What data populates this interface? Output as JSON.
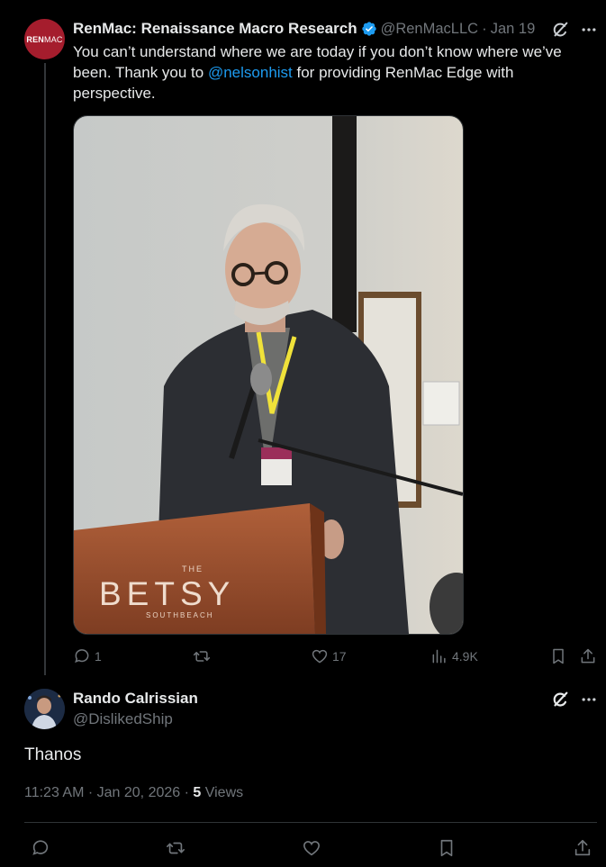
{
  "tweet": {
    "author_name": "RenMac: Renaissance Macro Research",
    "handle": "@RenMacLLC",
    "separator": "·",
    "date": "Jan 19",
    "avatar_text_bold": "REN",
    "avatar_text_light": "MAC",
    "text_before": "You can’t understand where we are today if you don’t know where we’ve been.  Thank you to ",
    "mention": "@nelsonhist",
    "text_after": " for providing RenMac Edge with perspective.",
    "photo": {
      "podium_small_top": "THE",
      "podium_brand": "BETSY",
      "podium_small_bottom": "SOUTHBEACH"
    },
    "actions": {
      "replies": "1",
      "reposts": "",
      "likes": "17",
      "views": "4.9K"
    }
  },
  "reply": {
    "author_name": "Rando Calrissian",
    "handle": "@DislikedShip",
    "text": "Thanos",
    "time": "11:23 AM · Jan 20, 2026 · ",
    "views_count": "5",
    "views_label": " Views"
  },
  "colors": {
    "background": "#000000",
    "text": "#e7e9ea",
    "muted": "#71767b",
    "link": "#1d9bf0",
    "avatar_brand": "#a51d2d"
  },
  "icons": [
    "verified-badge-icon",
    "grok-icon",
    "more-icon",
    "reply-icon",
    "repost-icon",
    "like-icon",
    "views-icon",
    "bookmark-icon",
    "share-icon"
  ]
}
